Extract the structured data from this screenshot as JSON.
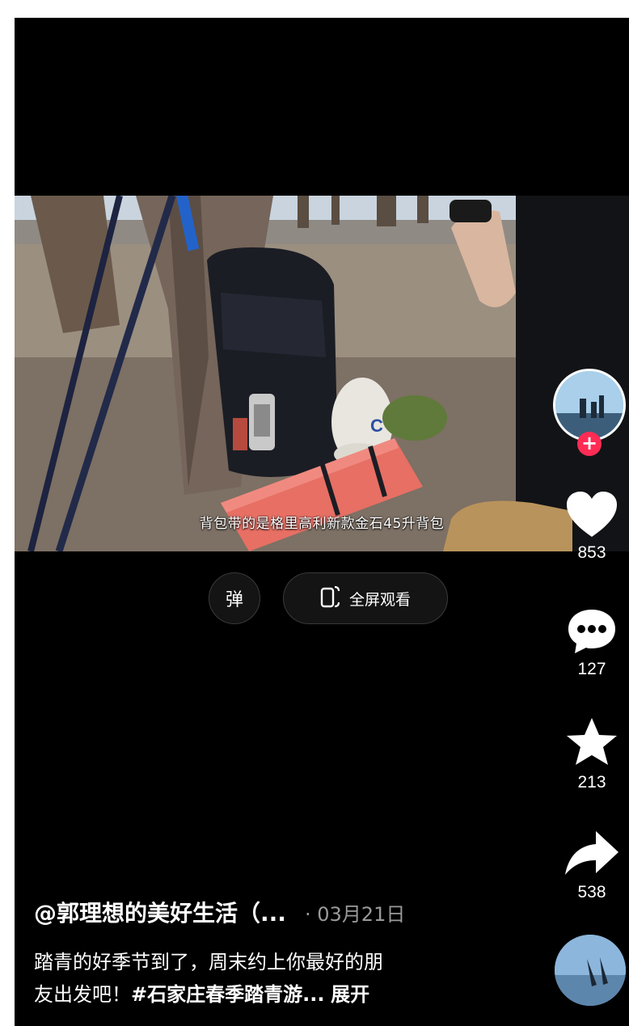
{
  "video": {
    "subtitle": "背包带的是格里高利新款金石45升背包"
  },
  "controls": {
    "danmu_label": "弹",
    "fullscreen_label": "全屏观看"
  },
  "rail": {
    "likes": "853",
    "comments": "127",
    "favorites": "213",
    "shares": "538",
    "follow_symbol": "+"
  },
  "caption": {
    "author": "@郭理想的美好生活（...",
    "date": "· 03月21日",
    "line1": "踏青的好季节到了，周末约上你最好的朋",
    "line2_text": "友出发吧！",
    "hashtag": "#石家庄春季踏青游...",
    "expand": "展开"
  },
  "colors": {
    "accent_red": "#fe2c55",
    "background": "#000000",
    "muted_text": "#9a9a9a"
  },
  "icons": [
    "heart-icon",
    "comment-icon",
    "star-icon",
    "share-icon",
    "fullscreen-phone-icon",
    "plus-icon",
    "music-disc"
  ]
}
